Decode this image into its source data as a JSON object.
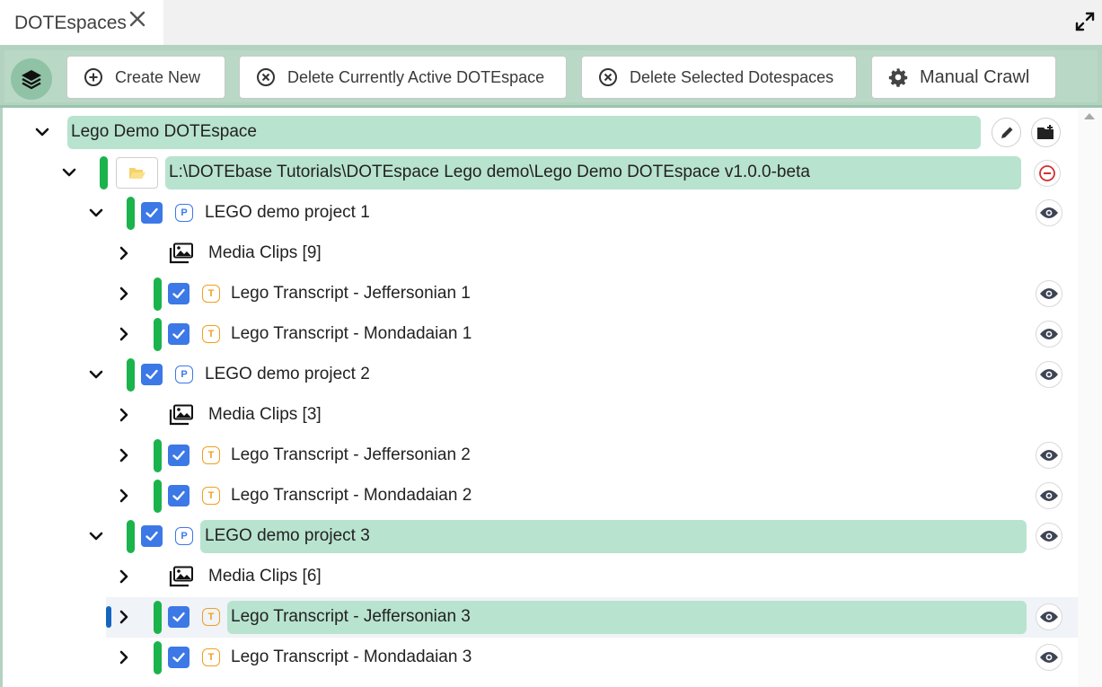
{
  "tab": {
    "title": "DOTEspaces"
  },
  "toolbar": {
    "create_new": "Create New",
    "delete_active": "Delete Currently Active DOTEspace",
    "delete_selected": "Delete Selected Dotespaces",
    "manual_crawl": "Manual Crawl"
  },
  "tree": {
    "root": {
      "label": "Lego Demo DOTEspace"
    },
    "path": {
      "label": "L:\\DOTEbase Tutorials\\DOTEspace Lego demo\\Lego Demo DOTEspace v1.0.0-beta"
    },
    "projects": [
      {
        "tag": "P",
        "label": "LEGO demo project 1",
        "media": "Media Clips [9]",
        "transcripts": [
          {
            "tag": "T",
            "label": "Lego Transcript - Jeffersonian 1"
          },
          {
            "tag": "T",
            "label": "Lego Transcript - Mondadaian 1"
          }
        ]
      },
      {
        "tag": "P",
        "label": "LEGO demo project 2",
        "media": "Media Clips [3]",
        "transcripts": [
          {
            "tag": "T",
            "label": "Lego Transcript - Jeffersonian 2"
          },
          {
            "tag": "T",
            "label": "Lego Transcript - Mondadaian 2"
          }
        ]
      },
      {
        "tag": "P",
        "label": "LEGO demo project 3",
        "media": "Media Clips [6]",
        "transcripts": [
          {
            "tag": "T",
            "label": "Lego Transcript - Jeffersonian 3"
          },
          {
            "tag": "T",
            "label": "Lego Transcript - Mondadaian 3"
          }
        ]
      }
    ]
  },
  "colors": {
    "accent_green": "#1bb34c",
    "highlight": "#b8e3cf",
    "checkbox_blue": "#3c78e6",
    "transcript_orange": "#f0a020",
    "toolbar_bg": "#b9d8c5"
  }
}
